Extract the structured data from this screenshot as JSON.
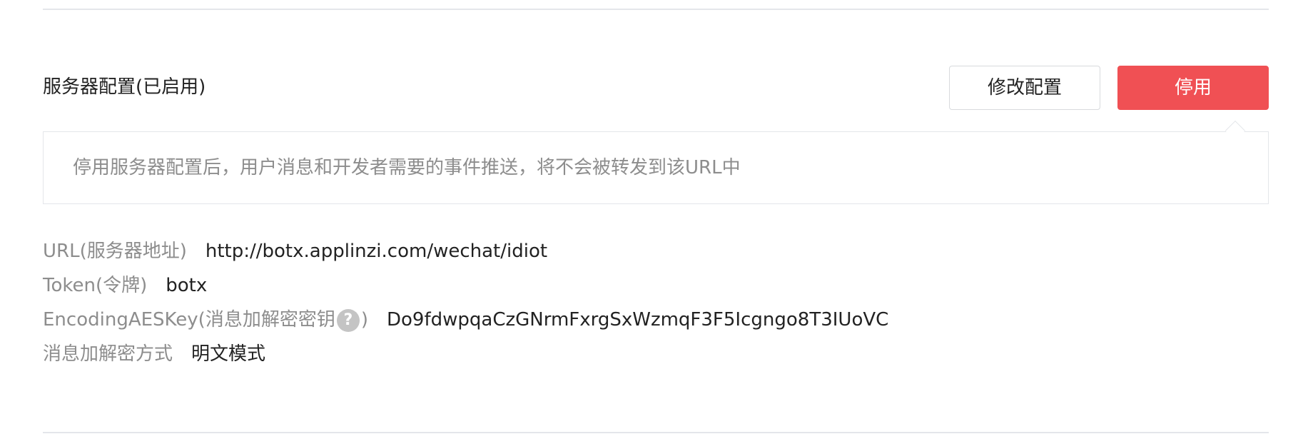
{
  "section": {
    "title": "服务器配置(已启用)"
  },
  "buttons": {
    "modify_label": "修改配置",
    "disable_label": "停用"
  },
  "tip": {
    "text": "停用服务器配置后，用户消息和开发者需要的事件推送，将不会被转发到该URL中"
  },
  "config": {
    "url": {
      "label": "URL(服务器地址)",
      "value": "http://botx.applinzi.com/wechat/idiot"
    },
    "token": {
      "label": "Token(令牌)",
      "value": "botx"
    },
    "aes_key": {
      "label_prefix": "EncodingAESKey(消息加解密密钥",
      "help_glyph": "?",
      "label_suffix": ")",
      "value": "Do9fdwpqaCzGNrmFxrgSxWzmqF3F5Icgngo8T3IUoVC"
    },
    "encrypt_mode": {
      "label": "消息加解密方式",
      "value": "明文模式"
    }
  },
  "colors": {
    "accent_danger": "#f05054",
    "label_gray": "#8d8d8d",
    "text_dark": "#222222",
    "border": "#e4e6ea"
  },
  "icons": {
    "help": "question-circle-icon"
  }
}
